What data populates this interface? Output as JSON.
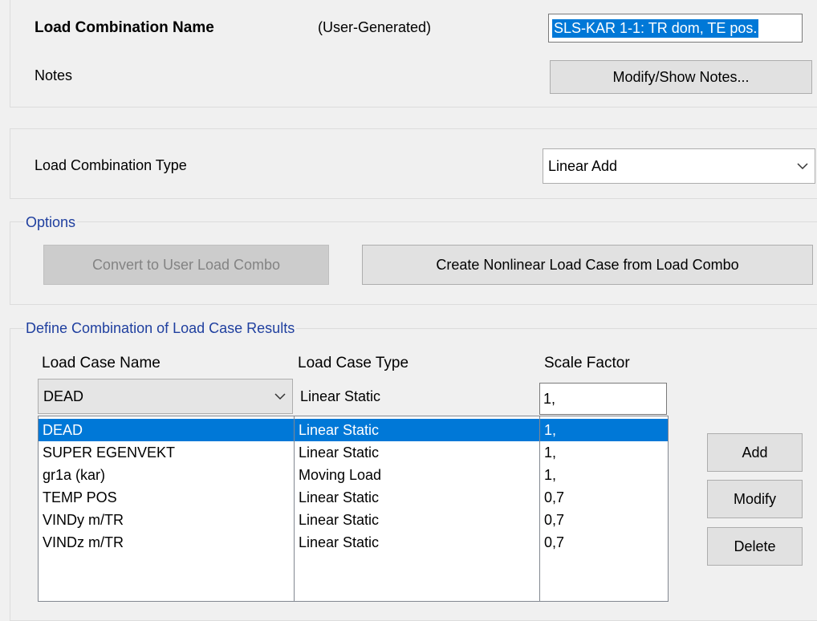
{
  "combo_name": {
    "label": "Load Combination Name",
    "source": "(User-Generated)",
    "value": "SLS-KAR 1-1: TR dom, TE pos."
  },
  "notes": {
    "label": "Notes",
    "button": "Modify/Show Notes..."
  },
  "combo_type": {
    "label": "Load Combination Type",
    "value": "Linear Add"
  },
  "options": {
    "legend": "Options",
    "convert_button": "Convert to User Load Combo",
    "create_button": "Create Nonlinear Load Case from Load Combo"
  },
  "define": {
    "legend": "Define Combination of Load Case Results",
    "headers": {
      "name": "Load Case Name",
      "type": "Load Case Type",
      "scale": "Scale Factor"
    },
    "current": {
      "name": "DEAD",
      "type": "Linear Static",
      "scale": "1,"
    },
    "rows": [
      {
        "name": "DEAD",
        "type": "Linear Static",
        "scale": "1,"
      },
      {
        "name": "SUPER EGENVEKT",
        "type": "Linear Static",
        "scale": "1,"
      },
      {
        "name": "gr1a (kar)",
        "type": "Moving Load",
        "scale": "1,"
      },
      {
        "name": "TEMP POS",
        "type": "Linear Static",
        "scale": "0,7"
      },
      {
        "name": "VINDy m/TR",
        "type": "Linear Static",
        "scale": "0,7"
      },
      {
        "name": "VINDz m/TR",
        "type": "Linear Static",
        "scale": "0,7"
      }
    ],
    "selected_row": 0,
    "buttons": {
      "add": "Add",
      "modify": "Modify",
      "delete": "Delete"
    }
  },
  "colors": {
    "selection": "#0078d7",
    "legend_text": "#1f3f9f"
  }
}
